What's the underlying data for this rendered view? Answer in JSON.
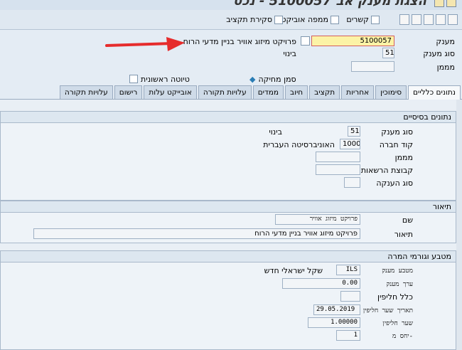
{
  "window": {
    "title": "הצגת מענק אב 5100057 - נכס"
  },
  "toolbar": {
    "budget_close": "סקירת תקציב",
    "object_map": "ממפה אוביקט",
    "links": "קשרים"
  },
  "header": {
    "grant_label": "מענק",
    "grant_value": "5100057",
    "grant_desc": "פרויקט מיזוג אוויר בניין מדעי הרוח",
    "grant_type_label": "סוג מענק",
    "grant_type_value": "51",
    "grant_type_desc": "בינוי",
    "funder_label": "מממן",
    "delete_flag_label": "סמן מחיקה",
    "draft_label": "טיוטה ראשונית"
  },
  "tabs": [
    "נתונים כלליים",
    "סימוכין",
    "אחריות",
    "תקציב",
    "חיוב",
    "ממדים",
    "עלויות תקורה",
    "אובייקט עלות",
    "רישום",
    "עלויות תקורה"
  ],
  "basic": {
    "title": "נתונים בסיסיים",
    "grant_type_label": "סוג מענק",
    "grant_type_value": "51",
    "grant_type_desc": "בינוי",
    "company_label": "קוד חברה",
    "company_value": "1000",
    "company_desc": "האוניברסיטה העברית",
    "funder_label": "מממן",
    "authority_label": "קבוצת הרשאות",
    "award_type_label": "סוג הענקה"
  },
  "description": {
    "title": "תיאור",
    "name_label": "שם",
    "name_value": "פרויקט מיזוג אוויר",
    "desc_label": "תיאור",
    "desc_value": "פרויקט מיזוג אוויר בניין מדעי הרוח"
  },
  "currency": {
    "title": "מטבע וגורמי המרה",
    "currency_label": "מטבע מענק",
    "currency_value": "ILS",
    "currency_desc": "שקל ישראלי חדש",
    "value_label": "ערך מענק",
    "value_value": "0.00",
    "exchange_rule_label": "כלל חליפין",
    "rate_date_label": "תאריך שער חליפין",
    "rate_date_value": "29.05.2019",
    "rate_label": "שער חליפין",
    "rate_value": "1.00000",
    "ratio_label": "יחס מ-",
    "ratio_value": "1"
  }
}
